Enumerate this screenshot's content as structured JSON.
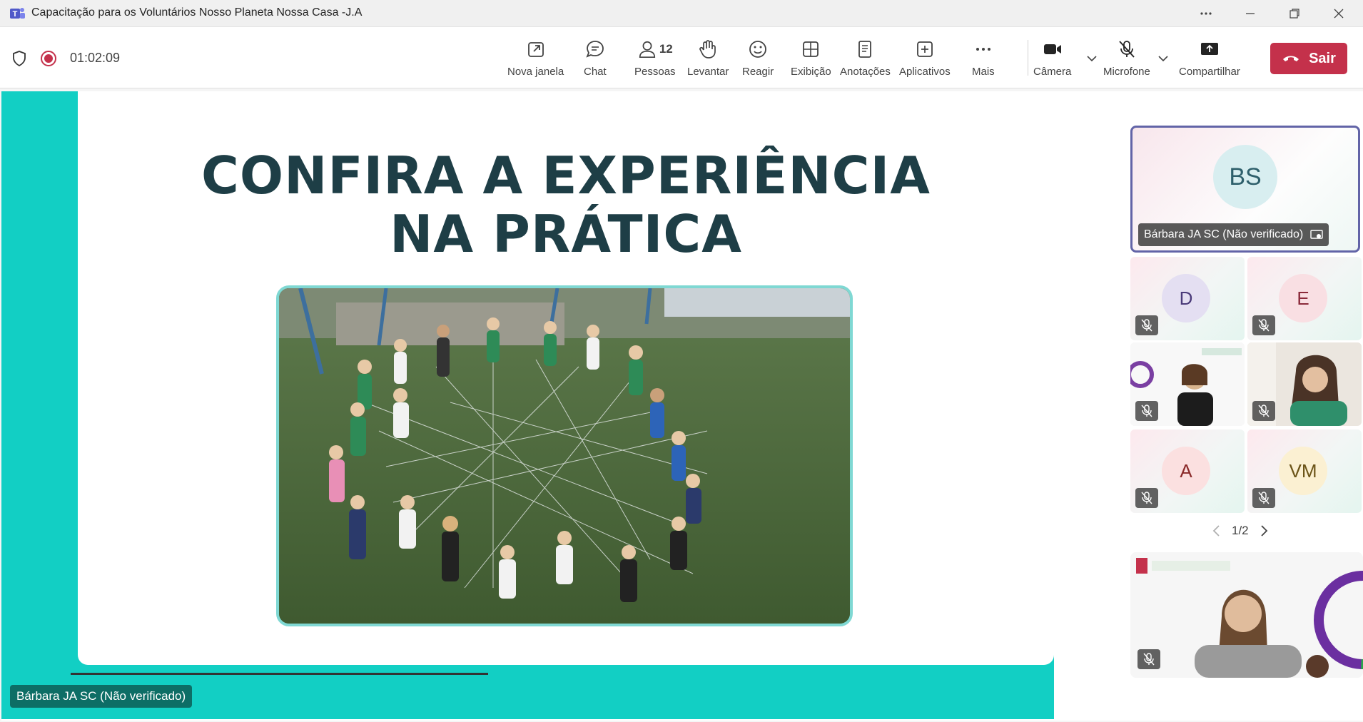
{
  "window": {
    "title": "Capacitação para os Voluntários Nosso Planeta Nossa Casa -J.A",
    "controls": [
      "more-icon",
      "minimize-icon",
      "maximize-icon",
      "close-icon"
    ]
  },
  "meeting": {
    "timer": "01:02:09",
    "people_count": "12"
  },
  "toolbar": {
    "new_window": "Nova janela",
    "chat": "Chat",
    "people": "Pessoas",
    "raise": "Levantar",
    "react": "Reagir",
    "view": "Exibição",
    "notes": "Anotações",
    "apps": "Aplicativos",
    "more": "Mais",
    "camera": "Câmera",
    "microphone": "Microfone",
    "share": "Compartilhar",
    "leave": "Sair"
  },
  "slide": {
    "title_line1": "CONFIRA A EXPERIÊNCIA",
    "title_line2": "NA PRÁTICA",
    "photo_subject": "children-playing-yarn-web-on-field"
  },
  "presenter": {
    "name": "Bárbara JA SC (Não verificado)"
  },
  "participants": {
    "featured": {
      "initials": "BS",
      "name": "Bárbara JA SC (Não verificado)"
    },
    "tiles": [
      {
        "initials": "D",
        "color": "#e4dff2",
        "text_color": "#4b3b7a"
      },
      {
        "initials": "E",
        "color": "#f9dfe3",
        "text_color": "#8a2a3a"
      },
      {
        "initials": "",
        "video": true
      },
      {
        "initials": "",
        "video": true
      },
      {
        "initials": "A",
        "color": "#fbe0e0",
        "text_color": "#8a2a2a"
      },
      {
        "initials": "VM",
        "color": "#fbf0d2",
        "text_color": "#6b5418"
      }
    ],
    "page": "1/2"
  },
  "colors": {
    "slide_bg": "#12cfc4",
    "title": "#1e3e46",
    "leave": "#c4314b",
    "accent": "#6264a7"
  }
}
